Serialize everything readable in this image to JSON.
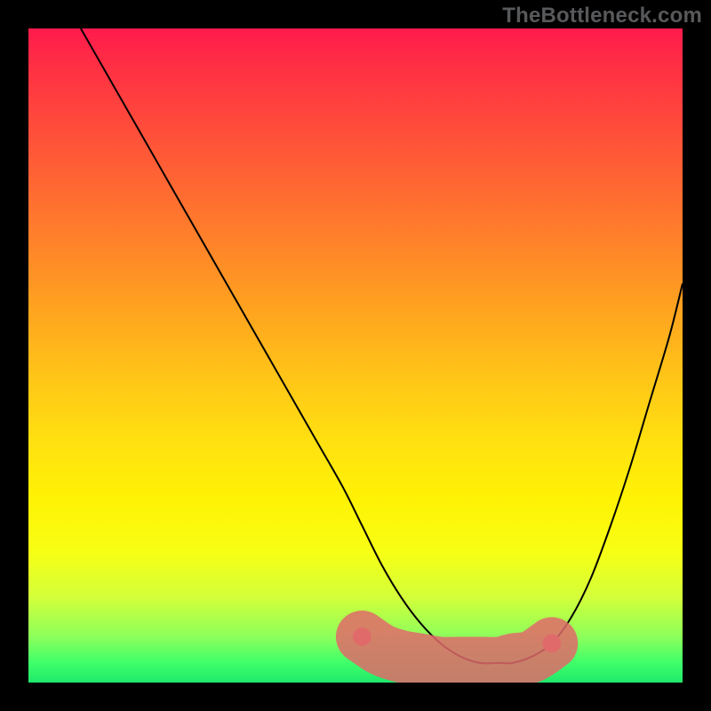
{
  "watermark": "TheBottleneck.com",
  "chart_data": {
    "type": "line",
    "title": "",
    "xlabel": "",
    "ylabel": "",
    "xlim": [
      0,
      100
    ],
    "ylim": [
      0,
      100
    ],
    "gradient_stops": [
      {
        "pos": 0.0,
        "color": "#ff1a4d"
      },
      {
        "pos": 0.06,
        "color": "#ff3043"
      },
      {
        "pos": 0.18,
        "color": "#ff5538"
      },
      {
        "pos": 0.3,
        "color": "#ff7a2c"
      },
      {
        "pos": 0.42,
        "color": "#ffa020"
      },
      {
        "pos": 0.53,
        "color": "#ffc418"
      },
      {
        "pos": 0.63,
        "color": "#ffe010"
      },
      {
        "pos": 0.72,
        "color": "#fff205"
      },
      {
        "pos": 0.8,
        "color": "#f7ff14"
      },
      {
        "pos": 0.87,
        "color": "#d3ff3a"
      },
      {
        "pos": 0.93,
        "color": "#8cff5b"
      },
      {
        "pos": 0.97,
        "color": "#3eff6a"
      },
      {
        "pos": 1.0,
        "color": "#20e86a"
      }
    ],
    "series": [
      {
        "name": "bottleneck-curve",
        "x": [
          8,
          12,
          16,
          20,
          24,
          28,
          32,
          36,
          40,
          44,
          48,
          51,
          54,
          57,
          60,
          63,
          66,
          69,
          72,
          74,
          77,
          80,
          83,
          86,
          89,
          92,
          95,
          98,
          100
        ],
        "y": [
          100,
          93,
          86,
          79,
          72,
          65,
          58,
          51,
          44,
          37,
          30,
          24,
          18,
          13,
          9,
          6,
          4,
          3,
          3,
          3,
          4,
          6,
          10,
          16,
          24,
          33,
          43,
          53,
          61
        ]
      }
    ],
    "marker_region": {
      "name": "optimal-zone",
      "color": "#e06a6a",
      "x": [
        51,
        54,
        57,
        60,
        63,
        66,
        69,
        72,
        74,
        77,
        80
      ],
      "y": [
        7,
        5,
        4,
        3.5,
        3,
        3,
        3,
        3,
        3.5,
        4,
        6
      ]
    }
  }
}
